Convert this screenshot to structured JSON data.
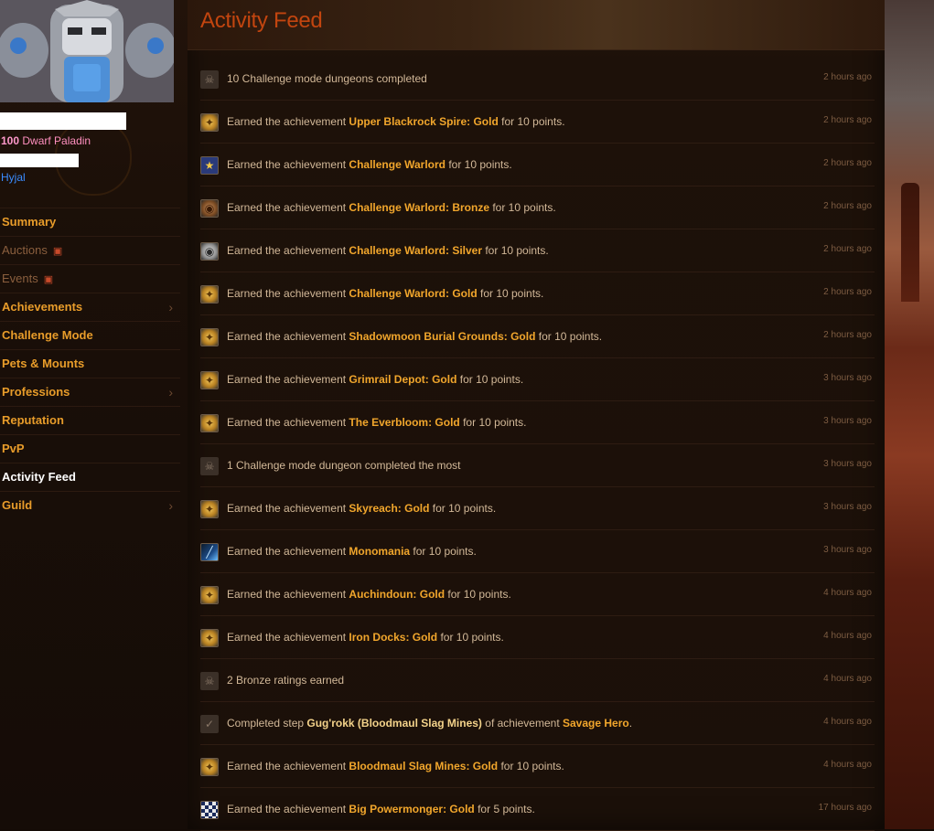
{
  "character": {
    "level": "100",
    "race_class": "Dwarf Paladin",
    "realm": "Hyjal"
  },
  "nav": [
    {
      "label": "Summary",
      "state": "normal",
      "chevron": false,
      "locked": false
    },
    {
      "label": "Auctions",
      "state": "disabled",
      "chevron": false,
      "locked": true
    },
    {
      "label": "Events",
      "state": "disabled",
      "chevron": false,
      "locked": true
    },
    {
      "label": "Achievements",
      "state": "normal",
      "chevron": true,
      "locked": false
    },
    {
      "label": "Challenge Mode",
      "state": "normal",
      "chevron": false,
      "locked": false
    },
    {
      "label": "Pets & Mounts",
      "state": "normal",
      "chevron": false,
      "locked": false
    },
    {
      "label": "Professions",
      "state": "normal",
      "chevron": true,
      "locked": false
    },
    {
      "label": "Reputation",
      "state": "normal",
      "chevron": false,
      "locked": false
    },
    {
      "label": "PvP",
      "state": "normal",
      "chevron": false,
      "locked": false
    },
    {
      "label": "Activity Feed",
      "state": "active",
      "chevron": false,
      "locked": false
    },
    {
      "label": "Guild",
      "state": "normal",
      "chevron": true,
      "locked": false
    }
  ],
  "page": {
    "title": "Activity Feed"
  },
  "feed": [
    {
      "icon": "skull",
      "parts": [
        {
          "t": "10 Challenge mode dungeons completed"
        }
      ],
      "time": "2 hours ago"
    },
    {
      "icon": "gold",
      "parts": [
        {
          "t": "Earned the achievement "
        },
        {
          "t": "Upper Blackrock Spire: Gold",
          "hl": 1
        },
        {
          "t": " for 10 points."
        }
      ],
      "time": "2 hours ago"
    },
    {
      "icon": "star",
      "parts": [
        {
          "t": "Earned the achievement "
        },
        {
          "t": "Challenge Warlord",
          "hl": 1
        },
        {
          "t": " for 10 points."
        }
      ],
      "time": "2 hours ago"
    },
    {
      "icon": "bronze",
      "parts": [
        {
          "t": "Earned the achievement "
        },
        {
          "t": "Challenge Warlord: Bronze",
          "hl": 1
        },
        {
          "t": " for 10 points."
        }
      ],
      "time": "2 hours ago"
    },
    {
      "icon": "silver",
      "parts": [
        {
          "t": "Earned the achievement "
        },
        {
          "t": "Challenge Warlord: Silver",
          "hl": 1
        },
        {
          "t": " for 10 points."
        }
      ],
      "time": "2 hours ago"
    },
    {
      "icon": "gold",
      "parts": [
        {
          "t": "Earned the achievement "
        },
        {
          "t": "Challenge Warlord: Gold",
          "hl": 1
        },
        {
          "t": " for 10 points."
        }
      ],
      "time": "2 hours ago"
    },
    {
      "icon": "gold",
      "parts": [
        {
          "t": "Earned the achievement "
        },
        {
          "t": "Shadowmoon Burial Grounds: Gold",
          "hl": 1
        },
        {
          "t": " for 10 points."
        }
      ],
      "time": "2 hours ago"
    },
    {
      "icon": "gold",
      "parts": [
        {
          "t": "Earned the achievement "
        },
        {
          "t": "Grimrail Depot: Gold",
          "hl": 1
        },
        {
          "t": " for 10 points."
        }
      ],
      "time": "3 hours ago"
    },
    {
      "icon": "gold",
      "parts": [
        {
          "t": "Earned the achievement "
        },
        {
          "t": "The Everbloom: Gold",
          "hl": 1
        },
        {
          "t": " for 10 points."
        }
      ],
      "time": "3 hours ago"
    },
    {
      "icon": "skull",
      "parts": [
        {
          "t": "1 Challenge mode dungeon completed the most"
        }
      ],
      "time": "3 hours ago"
    },
    {
      "icon": "gold",
      "parts": [
        {
          "t": "Earned the achievement "
        },
        {
          "t": "Skyreach: Gold",
          "hl": 1
        },
        {
          "t": " for 10 points."
        }
      ],
      "time": "3 hours ago"
    },
    {
      "icon": "blade",
      "parts": [
        {
          "t": "Earned the achievement "
        },
        {
          "t": "Monomania",
          "hl": 1
        },
        {
          "t": " for 10 points."
        }
      ],
      "time": "3 hours ago"
    },
    {
      "icon": "gold",
      "parts": [
        {
          "t": "Earned the achievement "
        },
        {
          "t": "Auchindoun: Gold",
          "hl": 1
        },
        {
          "t": " for 10 points."
        }
      ],
      "time": "4 hours ago"
    },
    {
      "icon": "gold",
      "parts": [
        {
          "t": "Earned the achievement "
        },
        {
          "t": "Iron Docks: Gold",
          "hl": 1
        },
        {
          "t": " for 10 points."
        }
      ],
      "time": "4 hours ago"
    },
    {
      "icon": "skull",
      "parts": [
        {
          "t": "2 Bronze ratings earned"
        }
      ],
      "time": "4 hours ago"
    },
    {
      "icon": "check",
      "parts": [
        {
          "t": "Completed step "
        },
        {
          "t": "Gug'rokk (Bloodmaul Slag Mines)",
          "hl": 2
        },
        {
          "t": " of achievement "
        },
        {
          "t": "Savage Hero",
          "hl": 1
        },
        {
          "t": "."
        }
      ],
      "time": "4 hours ago"
    },
    {
      "icon": "gold",
      "parts": [
        {
          "t": "Earned the achievement "
        },
        {
          "t": "Bloodmaul Slag Mines: Gold",
          "hl": 1
        },
        {
          "t": " for 10 points."
        }
      ],
      "time": "4 hours ago"
    },
    {
      "icon": "checker",
      "parts": [
        {
          "t": "Earned the achievement "
        },
        {
          "t": "Big Powermonger: Gold",
          "hl": 1
        },
        {
          "t": " for 5 points."
        }
      ],
      "time": "17 hours ago"
    }
  ]
}
